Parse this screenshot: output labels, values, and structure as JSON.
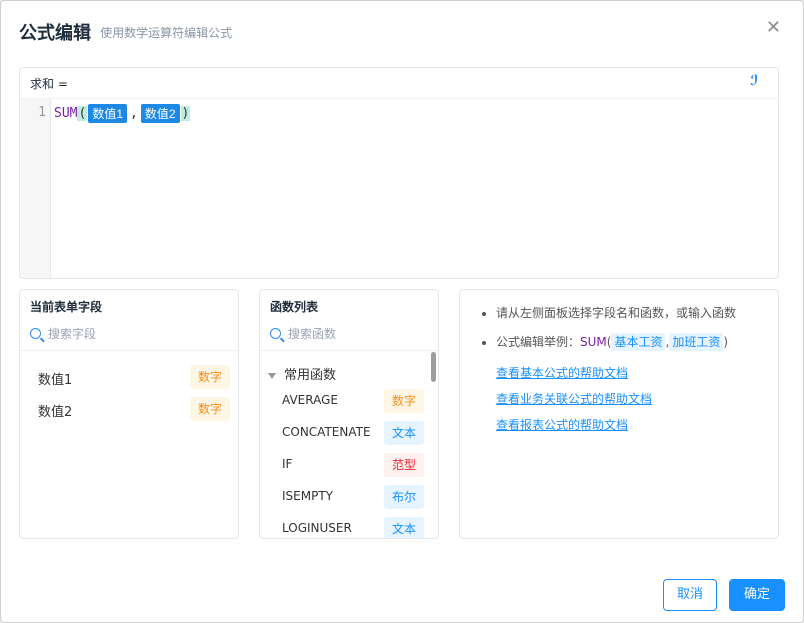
{
  "dialog": {
    "title": "公式编辑",
    "subtitle": "使用数学运算符编辑公式",
    "close_icon": "close-icon"
  },
  "editor": {
    "label": "求和 =",
    "line_number": "1",
    "function": "SUM",
    "open_paren": "(",
    "close_paren": ")",
    "comma": ",",
    "args": [
      "数值1",
      "数值2"
    ],
    "magic_icon": "format-wand-icon"
  },
  "fields_panel": {
    "title": "当前表单字段",
    "search_placeholder": "搜索字段",
    "items": [
      {
        "name": "数值1",
        "type": "数字"
      },
      {
        "name": "数值2",
        "type": "数字"
      }
    ]
  },
  "functions_panel": {
    "title": "函数列表",
    "search_placeholder": "搜索函数",
    "group_label": "常用函数",
    "items": [
      {
        "name": "AVERAGE",
        "type": "数字"
      },
      {
        "name": "CONCATENATE",
        "type": "文本"
      },
      {
        "name": "IF",
        "type": "范型"
      },
      {
        "name": "ISEMPTY",
        "type": "布尔"
      },
      {
        "name": "LOGINUSER",
        "type": "文本"
      }
    ]
  },
  "help_panel": {
    "tip1": "请从左侧面板选择字段名和函数，或输入函数",
    "tip2_prefix": "公式编辑举例：",
    "tip2_fn": "SUM",
    "tip2_open": "(",
    "tip2_arg1": "基本工资",
    "tip2_comma": ",",
    "tip2_arg2": "加班工资",
    "tip2_close": ")",
    "links": [
      "查看基本公式的帮助文档",
      "查看业务关联公式的帮助文档",
      "查看报表公式的帮助文档"
    ]
  },
  "footer": {
    "cancel_label": "取消",
    "ok_label": "确定"
  },
  "colors": {
    "accent": "#1890ff",
    "function_purple": "#7a1fa2",
    "tag_number_orange": "#fa8c16",
    "tag_range_red": "#f5222d"
  }
}
